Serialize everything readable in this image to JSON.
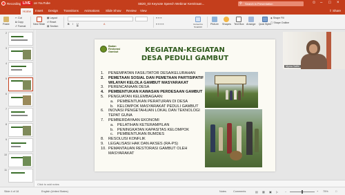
{
  "titlebar": {
    "recording_label": "Recording",
    "live_label": "LIVE",
    "youtube_label": "on YouTube",
    "document_title": "SB20_03 Keynote Speech Webinar Kemitraan...",
    "search_placeholder": "Search in Presentation",
    "accent": "#c43e1c"
  },
  "menu_tabs": [
    "Home",
    "Insert",
    "Design",
    "Transitions",
    "Animations",
    "Slide Show",
    "Review",
    "View"
  ],
  "share_label": "Share",
  "ribbon": {
    "paste": "Paste",
    "cut": "Cut",
    "copy": "Copy",
    "format": "Format",
    "new_slide": "New Slide",
    "layout": "Layout",
    "reset": "Reset",
    "section": "Section",
    "convert_smartart": "Convert to SmartArt",
    "picture": "Picture",
    "shapes": "Shapes",
    "text_box": "Text Box",
    "arrange": "Arrange",
    "quick_styles": "Quick Styles",
    "shape_fill": "Shape Fill",
    "shape_outline": "Shape Outline"
  },
  "thumbnails": [
    {
      "num": "2"
    },
    {
      "num": "3"
    },
    {
      "num": "4"
    },
    {
      "num": "5"
    },
    {
      "num": "6"
    },
    {
      "num": "7"
    },
    {
      "num": "8"
    },
    {
      "num": "9"
    },
    {
      "num": "10"
    },
    {
      "num": "11"
    }
  ],
  "slide": {
    "logo_text_1": "Badan",
    "logo_text_2": "Restorasi",
    "logo_text_3": "Gambut",
    "title_line1": "KEGIATAN-KEGIATAN",
    "title_line2": "DESA PEDULI GAMBUT",
    "items": [
      {
        "n": "1.",
        "text": "PENEMPATAN FASILITATOR DESA/KELURAHAN",
        "bold": false
      },
      {
        "n": "2.",
        "text": "PEMETAAN SOSIAL DAN PEMETAAN PARTISIPATIF WILAYAH KELOLA GAMBUT MASYARAKAT",
        "bold": true
      },
      {
        "n": "3.",
        "text": "PERENCANAAN DESA",
        "bold": false
      },
      {
        "n": "4.",
        "text": "PEMBENTUKAN KAWASAN PERDESAAN GAMBUT",
        "bold": true
      },
      {
        "n": "5.",
        "text": "PENGUATAN KELEMBAGAAN:",
        "bold": false
      },
      {
        "n": "a.",
        "text": "PEMBENTUKAN PERATURAN DI DESA",
        "sub": true
      },
      {
        "n": "b.",
        "text": "KELOMPOK MASYARAKAT PEDULI GAMBUT",
        "sub": true
      },
      {
        "n": "6.",
        "text": "INOVASI PENGETAHUAN LOKAL DAN TEKNOLOGI TEPAT GUNA",
        "bold": false
      },
      {
        "n": "7.",
        "text": "PEMBERDAYAAN EKONOMI",
        "bold": false
      },
      {
        "n": "a.",
        "text": "PELATIHAN KETERAMPILAN",
        "sub": true
      },
      {
        "n": "b.",
        "text": "PENINGKATAN KAPASITAS KELOMPOK",
        "sub": true
      },
      {
        "n": "c.",
        "text": "PEMBENTUKAN BUMDES",
        "sub": true
      },
      {
        "n": "8.",
        "text": "RESOLUSI KONFLIK",
        "bold": false
      },
      {
        "n": "9.",
        "text": "LEGALISASI HAK DAN AKSES (RA-PS)",
        "bold": false
      },
      {
        "n": "10.",
        "text": "PEMANTAUAN RESTORASI GAMBUT OLEH MASYARAKAT",
        "bold": false
      }
    ]
  },
  "video": {
    "participant_name": "Myrna Safitri"
  },
  "notes_placeholder": "Click to add notes",
  "status": {
    "slide_indicator": "Slide 4 of 18",
    "language": "English (United States)",
    "notes_label": "Notes",
    "comments_label": "Comments",
    "zoom": "75%"
  }
}
